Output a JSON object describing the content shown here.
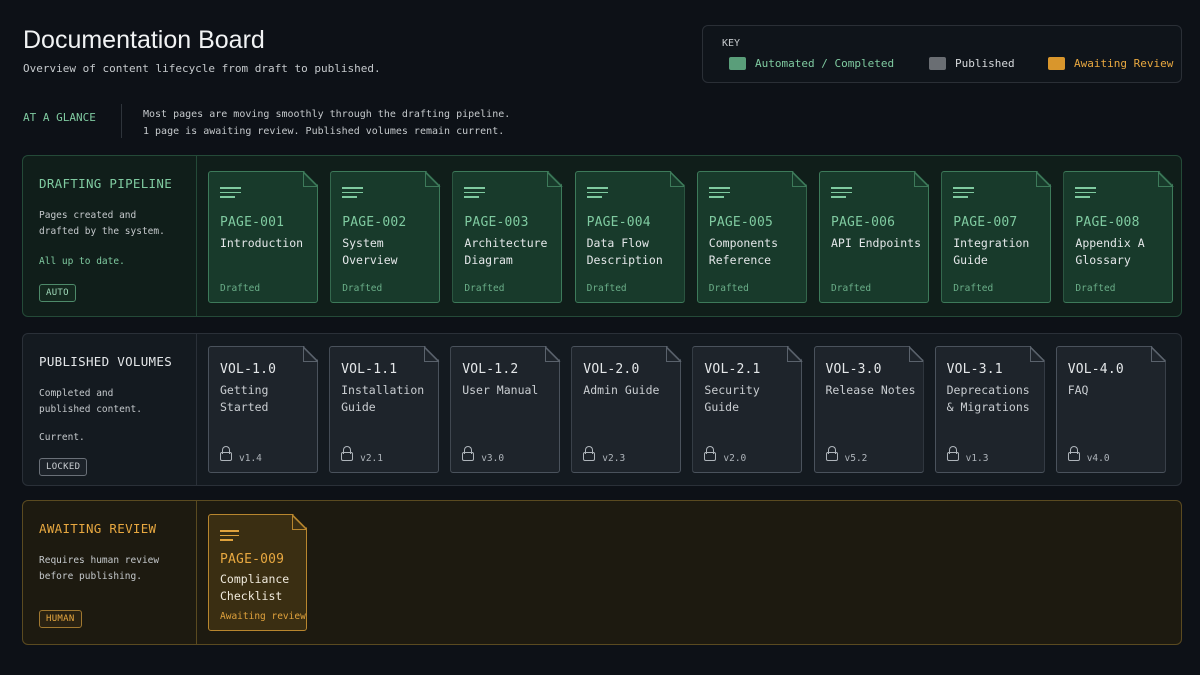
{
  "header": {
    "title": "Documentation Board",
    "subtitle": "Overview of content lifecycle from draft to published."
  },
  "key": {
    "title": "KEY",
    "items": [
      {
        "label": "Automated / Completed",
        "color": "#5a9e7a"
      },
      {
        "label": "Published",
        "color": "#6a6e73"
      },
      {
        "label": "Awaiting Review",
        "color": "#d9962c"
      }
    ]
  },
  "glance": {
    "label": "AT A GLANCE",
    "line1": "Most pages are moving smoothly through the drafting pipeline.",
    "line2": "1 page is awaiting review. Published volumes remain current."
  },
  "drafting": {
    "title": "DRAFTING PIPELINE",
    "desc": "Pages created and drafted by the system.",
    "note": "All up to date.",
    "badge": "AUTO",
    "color": "#7fcaa0",
    "cards": [
      {
        "id": "PAGE-001",
        "name": "Introduction",
        "status": "Drafted"
      },
      {
        "id": "PAGE-002",
        "name": "System Overview",
        "status": "Drafted"
      },
      {
        "id": "PAGE-003",
        "name": "Architecture Diagram",
        "status": "Drafted"
      },
      {
        "id": "PAGE-004",
        "name": "Data Flow Description",
        "status": "Drafted"
      },
      {
        "id": "PAGE-005",
        "name": "Components Reference",
        "status": "Drafted"
      },
      {
        "id": "PAGE-006",
        "name": "API Endpoints",
        "status": "Drafted"
      },
      {
        "id": "PAGE-007",
        "name": "Integration Guide",
        "status": "Drafted"
      },
      {
        "id": "PAGE-008",
        "name": "Appendix A Glossary",
        "status": "Drafted"
      }
    ]
  },
  "published": {
    "title": "PUBLISHED VOLUMES",
    "desc": "Completed and published content.",
    "note": "Current.",
    "badge": "LOCKED",
    "cards": [
      {
        "id": "VOL-1.0",
        "name": "Getting Started",
        "version": "v1.4"
      },
      {
        "id": "VOL-1.1",
        "name": "Installation Guide",
        "version": "v2.1"
      },
      {
        "id": "VOL-1.2",
        "name": "User Manual",
        "version": "v3.0"
      },
      {
        "id": "VOL-2.0",
        "name": "Admin Guide",
        "version": "v2.3"
      },
      {
        "id": "VOL-2.1",
        "name": "Security Guide",
        "version": "v2.0"
      },
      {
        "id": "VOL-3.0",
        "name": "Release Notes",
        "version": "v5.2"
      },
      {
        "id": "VOL-3.1",
        "name": "Deprecations & Migrations",
        "version": "v1.3"
      },
      {
        "id": "VOL-4.0",
        "name": "FAQ",
        "version": "v4.0"
      }
    ]
  },
  "review": {
    "title": "AWAITING REVIEW",
    "desc": "Requires human review before publishing.",
    "badge": "HUMAN",
    "color": "#e8a840",
    "cards": [
      {
        "id": "PAGE-009",
        "name": "Compliance Checklist",
        "status": "Awaiting review"
      }
    ]
  }
}
